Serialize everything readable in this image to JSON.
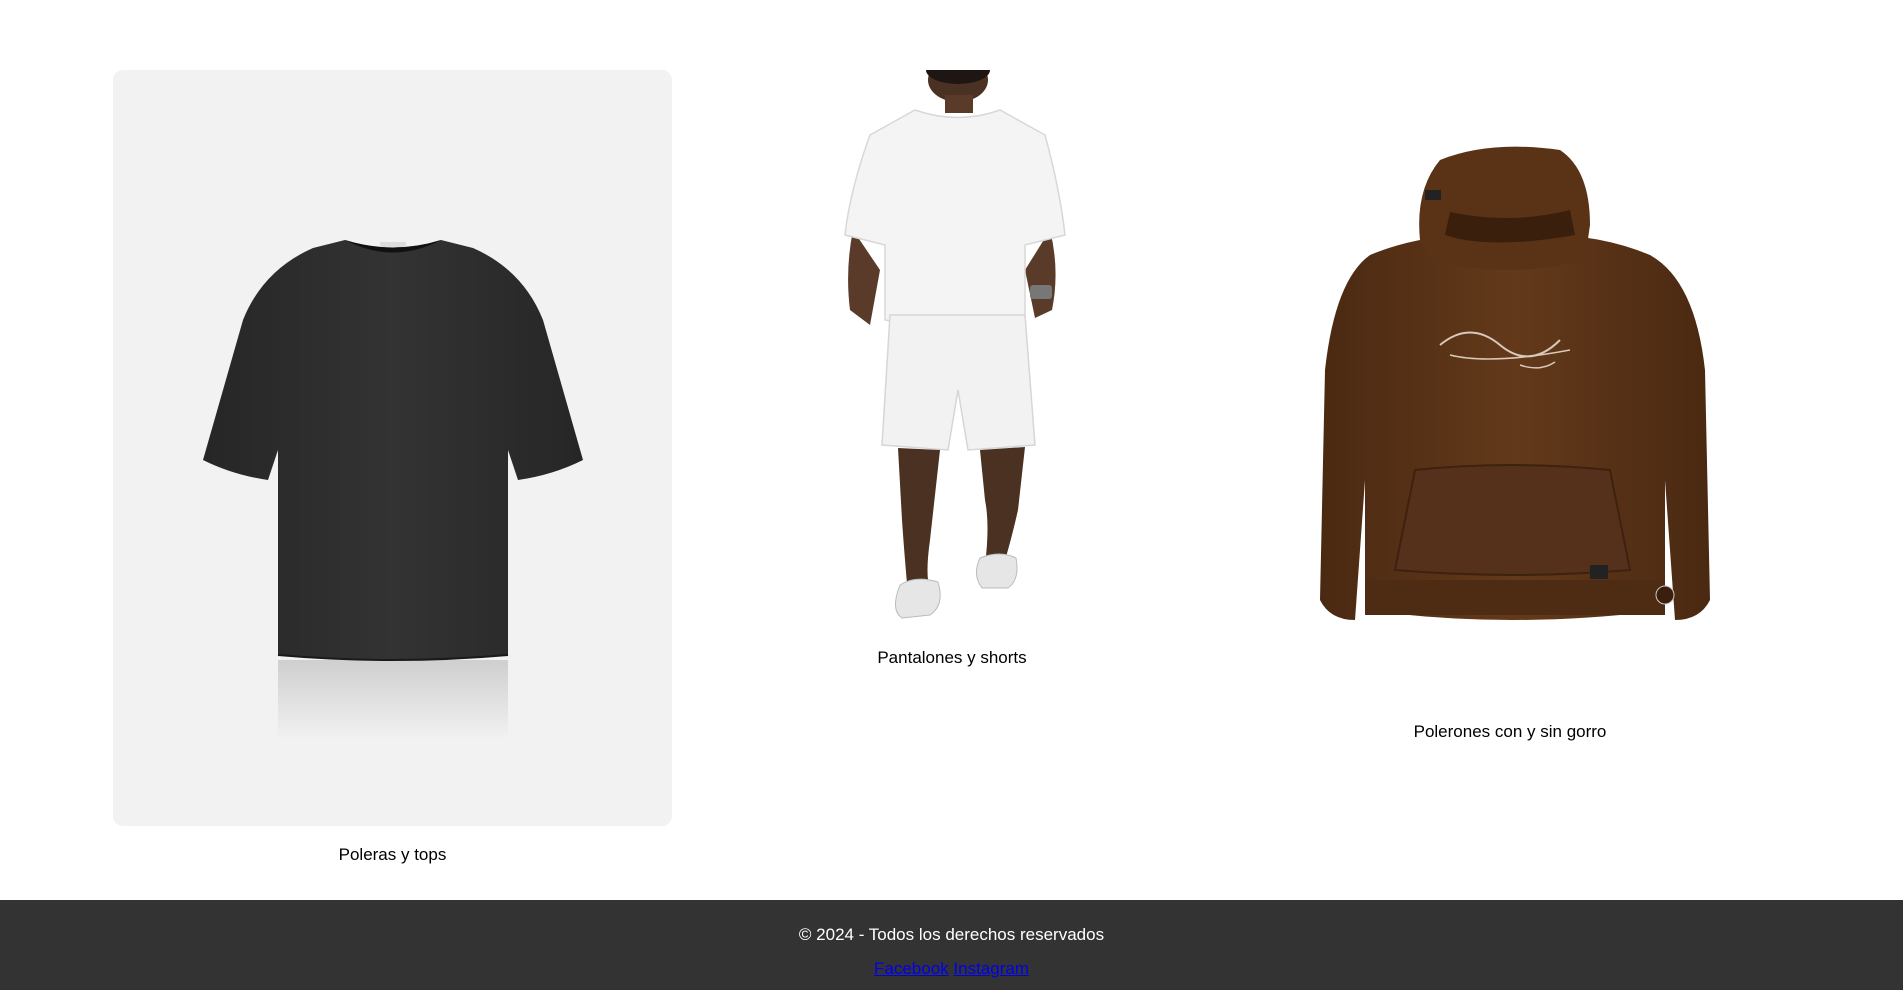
{
  "products": [
    {
      "caption": "Poleras y tops",
      "image_icon": "black-tshirt-image"
    },
    {
      "caption": "Pantalones y shorts",
      "image_icon": "white-tshirt-shorts-outfit-image"
    },
    {
      "caption": "Polerones con y sin gorro",
      "image_icon": "brown-hoodie-image"
    }
  ],
  "footer": {
    "copyright": "© 2024 - Todos los derechos reservados",
    "links": [
      {
        "label": "Facebook"
      },
      {
        "label": "Instagram"
      }
    ]
  },
  "colors": {
    "footer_bg": "#333333",
    "footer_text": "#ffffff",
    "link": "#0000ee",
    "card_bg": "#f2f2f2",
    "tshirt": "#2b2b2b",
    "hoodie": "#5a3316"
  }
}
